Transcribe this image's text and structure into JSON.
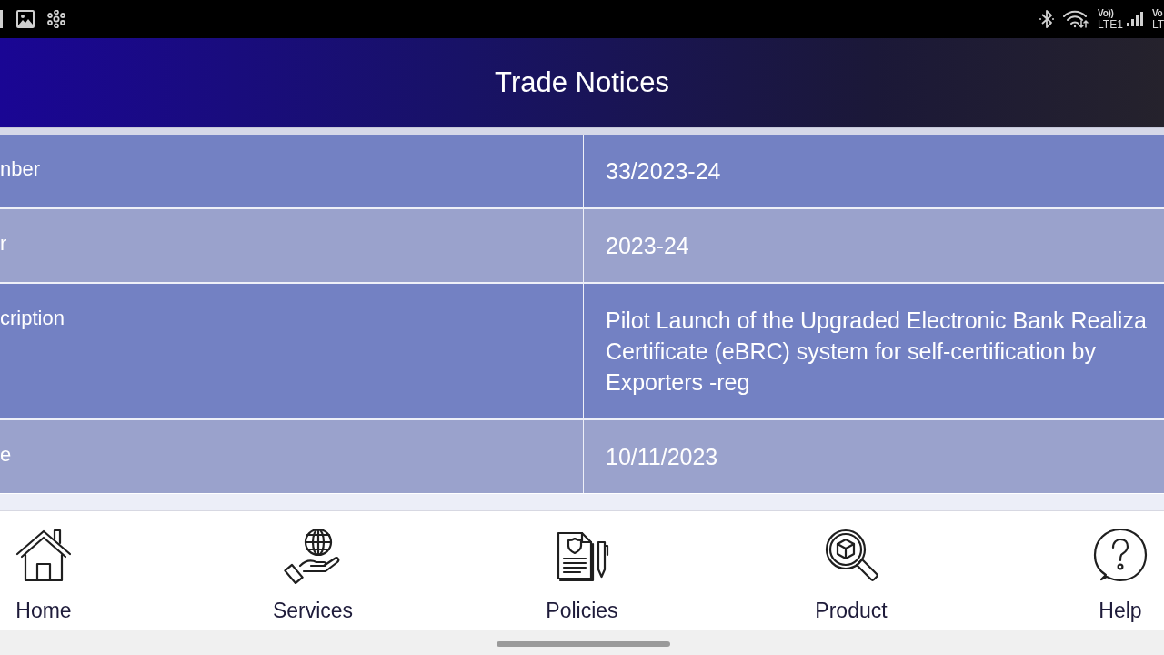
{
  "status_bar": {
    "sims": [
      {
        "voice": "Vo))",
        "network": "LTE1"
      },
      {
        "voice": "Vo",
        "network": "LT"
      }
    ]
  },
  "header": {
    "title": "Trade Notices"
  },
  "table": {
    "rows": [
      {
        "label": "nber",
        "value": [
          "33/2023-24"
        ]
      },
      {
        "label": "r",
        "value": [
          "2023-24"
        ]
      },
      {
        "label": "cription",
        "value": [
          "Pilot Launch of the Upgraded Electronic Bank Realiza",
          "Certificate (eBRC) system for self-certification by",
          "Exporters -reg"
        ]
      },
      {
        "label": "e",
        "value": [
          "10/11/2023"
        ]
      }
    ]
  },
  "bottom_nav": {
    "items": [
      {
        "kind": "home",
        "label": "Home"
      },
      {
        "kind": "services",
        "label": "Services"
      },
      {
        "kind": "policies",
        "label": "Policies"
      },
      {
        "kind": "product",
        "label": "Product"
      },
      {
        "kind": "help",
        "label": "Help"
      }
    ]
  }
}
